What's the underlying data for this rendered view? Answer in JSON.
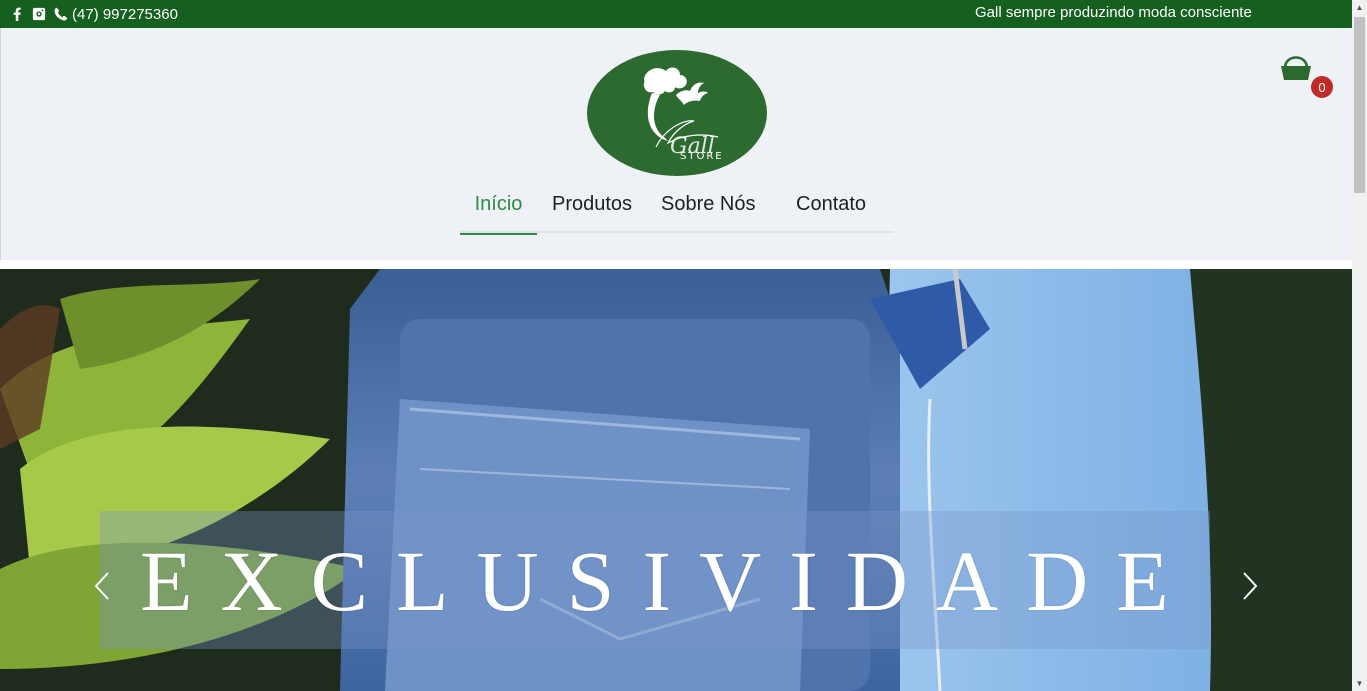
{
  "topbar": {
    "phone": "(47) 997275360",
    "tagline": "Gall sempre produzindo moda consciente",
    "icons": [
      "facebook-icon",
      "instagram-icon",
      "phone-icon"
    ],
    "background": "#15601f"
  },
  "logo": {
    "text_main": "Gall",
    "text_sub": "STORE",
    "color": "#2d6a2f"
  },
  "cart": {
    "count": "0",
    "icon": "basket-icon",
    "badge_color": "#c12b27"
  },
  "nav": {
    "items": [
      {
        "label": "Início",
        "active": true
      },
      {
        "label": "Produtos",
        "active": false
      },
      {
        "label": "Sobre Nós",
        "active": false
      },
      {
        "label": "Contato",
        "active": false
      }
    ],
    "accent": "#2e8b46"
  },
  "hero": {
    "title": "EXCLUSIVIDADE",
    "prev_icon": "chevron-left-icon",
    "next_icon": "chevron-right-icon"
  }
}
